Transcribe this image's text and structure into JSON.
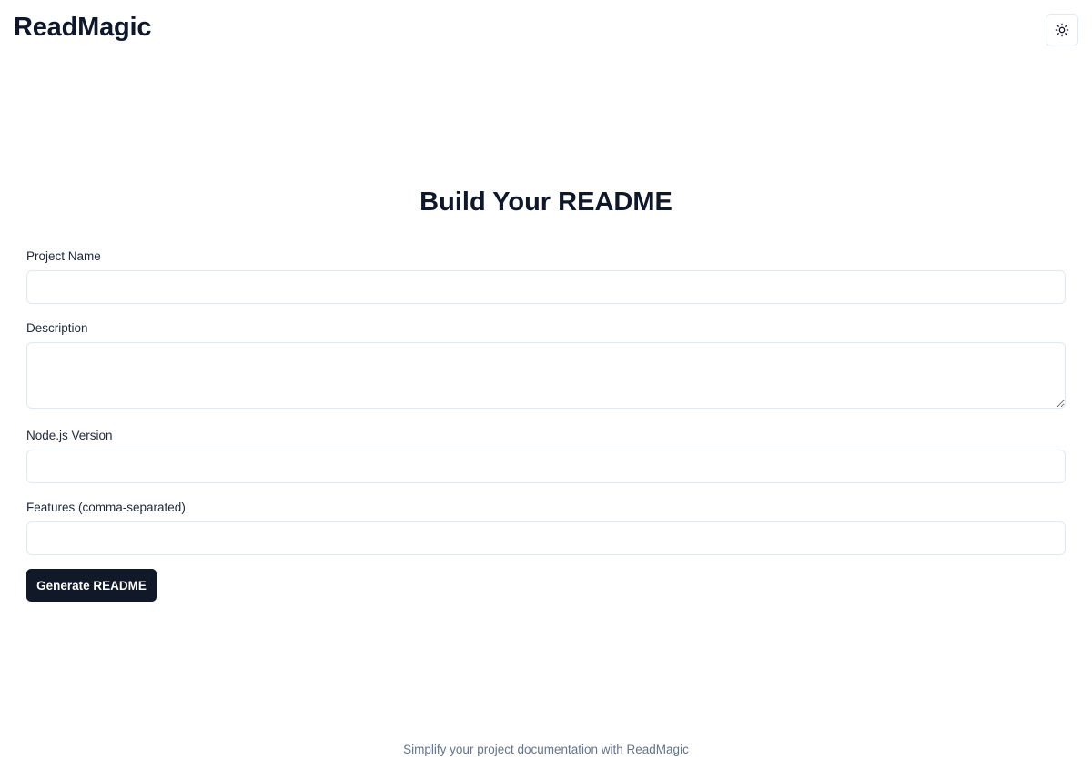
{
  "header": {
    "brand": "ReadMagic",
    "theme_toggle_icon": "sun-icon"
  },
  "main": {
    "title": "Build Your README",
    "fields": {
      "project_name": {
        "label": "Project Name",
        "value": "",
        "placeholder": ""
      },
      "description": {
        "label": "Description",
        "value": "",
        "placeholder": ""
      },
      "node_version": {
        "label": "Node.js Version",
        "value": "",
        "placeholder": ""
      },
      "features": {
        "label": "Features (comma-separated)",
        "value": "",
        "placeholder": ""
      }
    },
    "generate_button_label": "Generate README"
  },
  "footer": {
    "text": "Simplify your project documentation with ReadMagic"
  },
  "colors": {
    "primary_button": "#111827",
    "input_border": "#e2e8f0",
    "footer_text": "#64748b"
  }
}
